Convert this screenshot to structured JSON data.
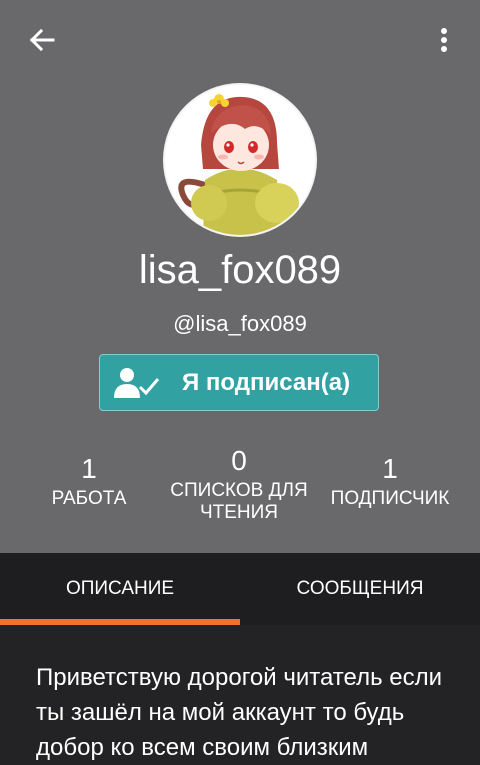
{
  "profile": {
    "username": "lisa_fox089",
    "handle": "@lisa_fox089"
  },
  "follow_button": {
    "label": "Я подписан(а)",
    "icon": "user-check-icon"
  },
  "stats": [
    {
      "value": "1",
      "label": "РАБОТА"
    },
    {
      "value": "0",
      "label": "СПИСКОВ ДЛЯ ЧТЕНИЯ"
    },
    {
      "value": "1",
      "label": "ПОДПИСЧИК"
    }
  ],
  "tabs": [
    {
      "label": "ОПИСАНИЕ",
      "active": true
    },
    {
      "label": "СООБЩЕНИЯ",
      "active": false
    }
  ],
  "description": "Приветствую дорогой читатель если ты зашёл на мой аккаунт то будь добор ко всем своим близким",
  "colors": {
    "header_bg": "#69686b",
    "page_bg": "#232325",
    "follow_button": "#31a1a2",
    "tab_indicator": "#f0712b"
  }
}
